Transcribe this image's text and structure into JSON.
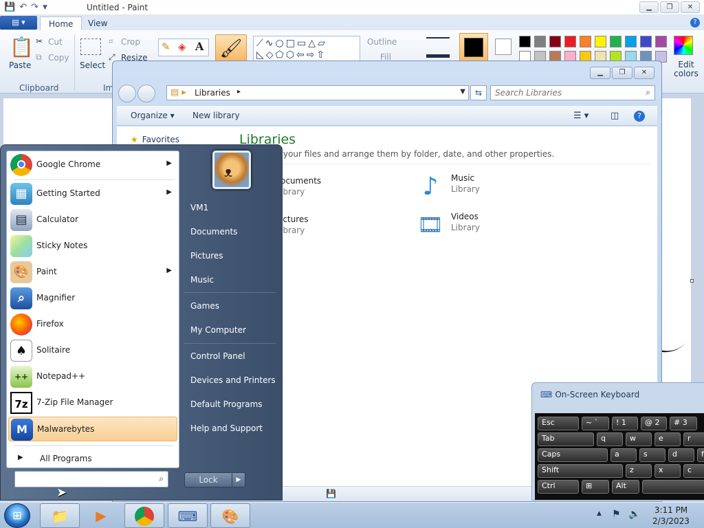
{
  "paint": {
    "title": "Untitled - Paint",
    "tabs": [
      "Home",
      "View"
    ],
    "clipboard": {
      "paste": "Paste",
      "cut": "Cut",
      "copy": "Copy",
      "group": "Clipboard"
    },
    "image": {
      "select": "Select",
      "crop": "Crop",
      "resize": "Resize",
      "group": "Im"
    },
    "shapes": {
      "outline": "Outline",
      "fill": "Fill"
    },
    "edit_colors": "Edit colors",
    "palette": [
      "#000000",
      "#7f7f7f",
      "#880015",
      "#ed1c24",
      "#ff7f27",
      "#fff200",
      "#22b14c",
      "#00a2e8",
      "#3f48cc",
      "#a349a4"
    ]
  },
  "explorer": {
    "address": "Libraries",
    "search_placeholder": "Search Libraries",
    "organize": "Organize",
    "new_library": "New library",
    "favorites": "Favorites",
    "heading": "Libraries",
    "description": "ary to see your files and arrange them by folder, date, and other properties.",
    "libraries": [
      {
        "name": "ocuments",
        "sub": "ibrary"
      },
      {
        "name": "Music",
        "sub": "Library"
      },
      {
        "name": "ictures",
        "sub": "ibrary"
      },
      {
        "name": "Videos",
        "sub": "Library"
      }
    ]
  },
  "start_menu": {
    "programs": [
      {
        "label": "Google Chrome",
        "arrow": "▶"
      },
      {
        "label": "Getting Started",
        "arrow": "▶"
      },
      {
        "label": "Calculator",
        "arrow": ""
      },
      {
        "label": "Sticky Notes",
        "arrow": ""
      },
      {
        "label": "Paint",
        "arrow": "▶"
      },
      {
        "label": "Magnifier",
        "arrow": ""
      },
      {
        "label": "Firefox",
        "arrow": ""
      },
      {
        "label": "Solitaire",
        "arrow": ""
      },
      {
        "label": "Notepad++",
        "arrow": ""
      },
      {
        "label": "7-Zip File Manager",
        "arrow": ""
      },
      {
        "label": "Malwarebytes",
        "arrow": ""
      }
    ],
    "all_programs": "All Programs",
    "search_value": "",
    "right_items": [
      "VM1",
      "Documents",
      "Pictures",
      "Music",
      "Games",
      "My Computer",
      "Control Panel",
      "Devices and Printers",
      "Default Programs",
      "Help and Support"
    ],
    "lock": "Lock"
  },
  "osk": {
    "title": "On-Screen Keyboard",
    "rows": [
      [
        "Esc",
        "~ `",
        "! 1",
        "@ 2",
        "# 3"
      ],
      [
        "Tab",
        "q",
        "w",
        "e",
        "r"
      ],
      [
        "Caps",
        "a",
        "s",
        "d",
        "f"
      ],
      [
        "Shift",
        "z",
        "x",
        "c"
      ],
      [
        "Ctrl",
        "⊞",
        "Alt",
        ""
      ]
    ]
  },
  "taskbar": {
    "time": "3:11 PM",
    "date": "2/3/2023"
  }
}
